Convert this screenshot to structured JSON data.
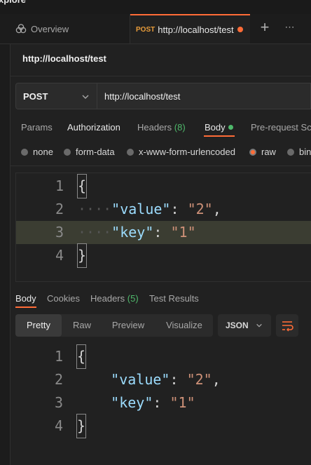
{
  "app": {
    "title_fragment": "xplore"
  },
  "tabs": [
    {
      "label": "Overview"
    },
    {
      "method": "POST",
      "label": "http://localhost/test"
    }
  ],
  "request": {
    "name": "http://localhost/test",
    "method": "POST",
    "url": "http://localhost/test",
    "tabs": {
      "params": "Params",
      "authorization": "Authorization",
      "headers": "Headers",
      "headers_count": "(8)",
      "body": "Body",
      "pre_request": "Pre-request Sc"
    },
    "body_modes": [
      "none",
      "form-data",
      "x-www-form-urlencoded",
      "raw",
      "bin"
    ],
    "selected_body_mode": "raw",
    "body_lines": [
      {
        "num": "1"
      },
      {
        "num": "2",
        "key": "\"value\"",
        "value": "\"2\""
      },
      {
        "num": "3",
        "key": "\"key\"",
        "value": "\"1\""
      },
      {
        "num": "4"
      }
    ]
  },
  "response": {
    "tabs": {
      "body": "Body",
      "cookies": "Cookies",
      "headers": "Headers",
      "headers_count": "(5)",
      "test_results": "Test Results"
    },
    "views": [
      "Pretty",
      "Raw",
      "Preview",
      "Visualize"
    ],
    "format": "JSON",
    "body_lines": [
      {
        "num": "1"
      },
      {
        "num": "2",
        "key": "\"value\"",
        "value": "\"2\""
      },
      {
        "num": "3",
        "key": "\"key\"",
        "value": "\"1\""
      },
      {
        "num": "4"
      }
    ]
  },
  "colors": {
    "accent": "#ff6c37",
    "success": "#4fb96b",
    "json_key": "#9cdcfe",
    "json_string": "#ce9178"
  }
}
